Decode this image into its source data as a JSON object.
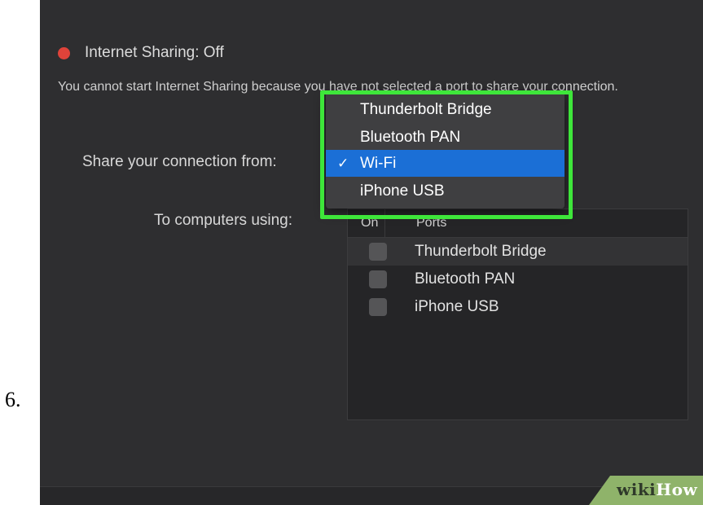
{
  "step_number": "6.",
  "status": {
    "dot_color": "#e0433a",
    "text": "Internet Sharing: Off"
  },
  "warning_text": "You cannot start Internet Sharing because you have not selected a port to share your connection.",
  "share_from_label": "Share your connection from:",
  "to_computers_label": "To computers using:",
  "ports_table": {
    "headers": {
      "on": "On",
      "ports": "Ports"
    },
    "rows": [
      {
        "name": "Thunderbolt Bridge",
        "checked": false
      },
      {
        "name": "Bluetooth PAN",
        "checked": false
      },
      {
        "name": "iPhone USB",
        "checked": false
      }
    ]
  },
  "dropdown": {
    "items": [
      {
        "label": "Thunderbolt Bridge",
        "selected": false
      },
      {
        "label": "Bluetooth PAN",
        "selected": false
      },
      {
        "label": "Wi-Fi",
        "selected": true
      },
      {
        "label": "iPhone USB",
        "selected": false
      }
    ],
    "checkmark": "✓",
    "selection_color": "#1b6fd6"
  },
  "highlight_color": "#3ee63a",
  "watermark": {
    "wiki": "wiki",
    "how": "How"
  }
}
